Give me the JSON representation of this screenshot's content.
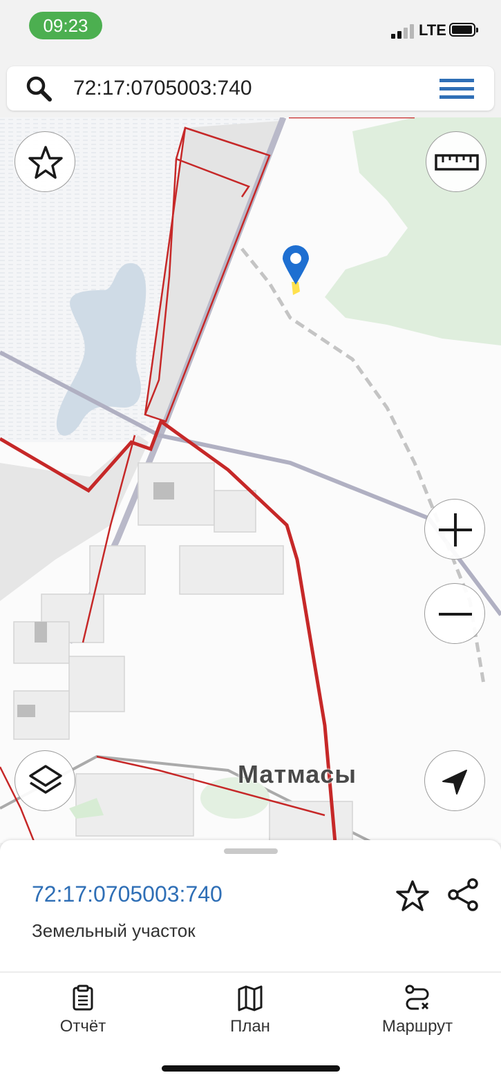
{
  "status_bar": {
    "time": "09:23",
    "network": "LTE"
  },
  "search": {
    "query": "72:17:0705003:740"
  },
  "map": {
    "place_label": "Матмасы"
  },
  "bottom_sheet": {
    "cadastral_number": "72:17:0705003:740",
    "object_type": "Земельный участок"
  },
  "tabs": [
    {
      "label": "Отчёт",
      "icon": "clipboard-icon"
    },
    {
      "label": "План",
      "icon": "map-icon"
    },
    {
      "label": "Маршрут",
      "icon": "route-icon"
    }
  ],
  "colors": {
    "accent": "#2f6fb6",
    "status_pill": "#4caf50",
    "parcel_border": "#c62828",
    "marker": "#1e6fd1"
  }
}
